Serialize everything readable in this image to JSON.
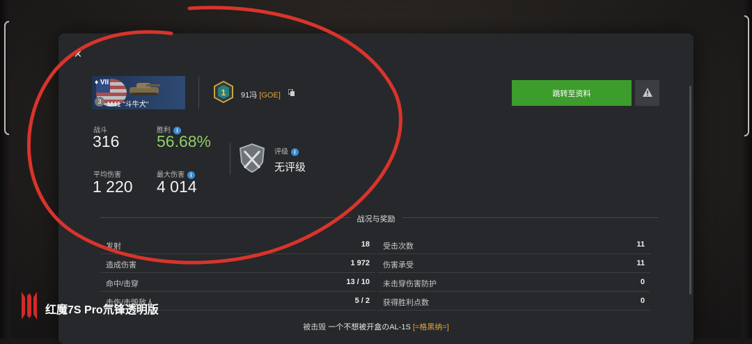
{
  "tank": {
    "tier": "VII",
    "name": "M41 \"斗牛犬\"",
    "mastery_level": "3"
  },
  "player": {
    "name": "91冯",
    "clan_tag": "[GOE]",
    "clan_emblem_label": "1"
  },
  "buttons": {
    "profile": "跳转至资料",
    "close": "×",
    "report": "!"
  },
  "stats": {
    "battles_label": "战斗",
    "battles_value": "316",
    "winrate_label": "胜利",
    "winrate_value": "56.68%",
    "avg_damage_label": "平均伤害",
    "avg_damage_value": "1 220",
    "max_damage_label": "最大伤害",
    "max_damage_value": "4 014",
    "rating_label": "评级",
    "rating_value": "无评级"
  },
  "section": {
    "title": "战况与奖励",
    "left": [
      {
        "label": "发射",
        "value": "18"
      },
      {
        "label": "造成伤害",
        "value": "1 972"
      },
      {
        "label": "命中/击穿",
        "value": "13 / 10"
      },
      {
        "label": "击伤/击毁敌人",
        "value": "5 / 2"
      }
    ],
    "right": [
      {
        "label": "受击次数",
        "value": "11"
      },
      {
        "label": "伤害承受",
        "value": "11"
      },
      {
        "label": "未击穿伤害防护",
        "value": "0"
      },
      {
        "label": "获得胜利点数",
        "value": "0"
      }
    ]
  },
  "footer": {
    "prefix": "被击毁",
    "killer": "一个不想被开盒のAL-1S",
    "killer_clan": "[=格黑纳=]"
  },
  "watermark": {
    "text": "红魔7S Pro氘锋透明版"
  },
  "colors": {
    "accent_green": "#3c9c2c",
    "winrate_green": "#8fce6b",
    "clan_orange": "#e8a33a",
    "annotation_red": "#d9342b",
    "info_blue": "#3a8fd6"
  }
}
